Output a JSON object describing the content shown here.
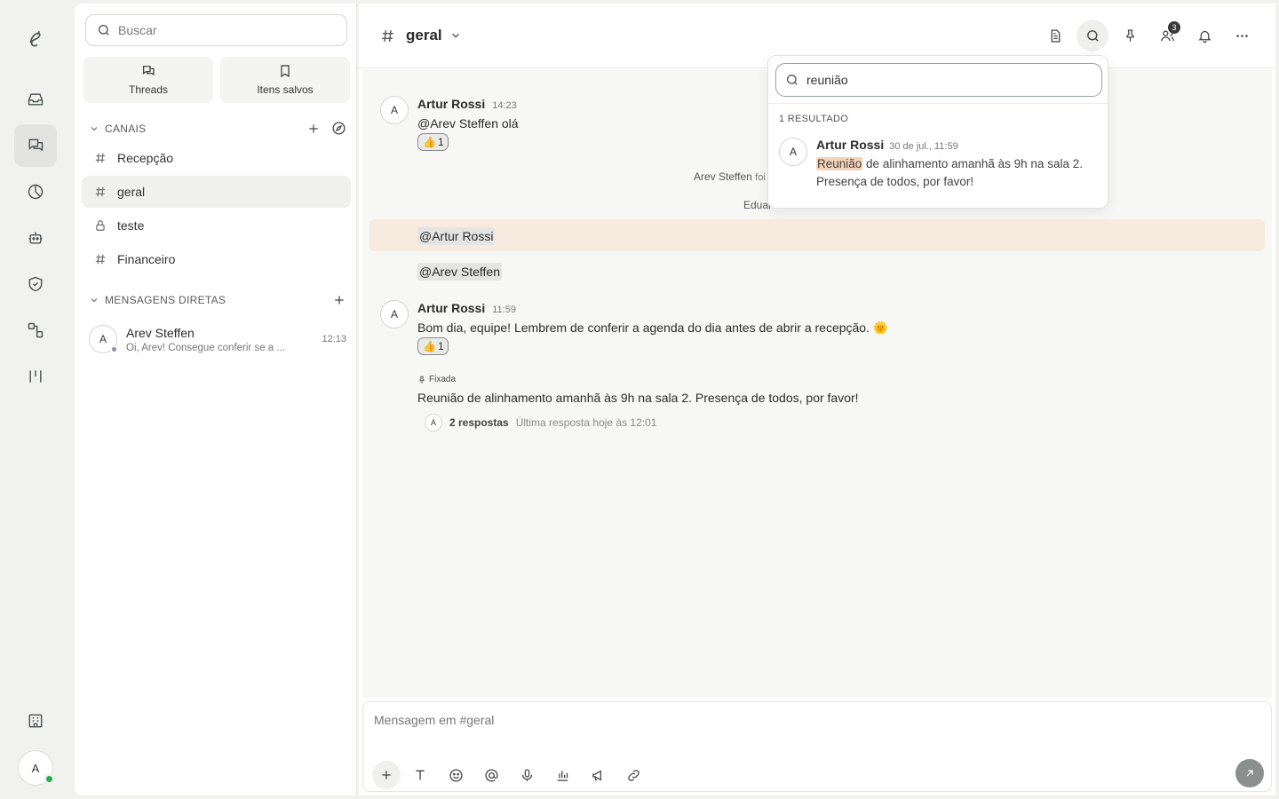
{
  "rail": {
    "icons": [
      "logo-icon",
      "inbox-icon",
      "chat-icon",
      "chart-icon",
      "bot-icon",
      "shield-icon",
      "integrations-icon",
      "kanban-icon",
      "building-icon"
    ],
    "user_initial": "A"
  },
  "sidebar": {
    "search_placeholder": "Buscar",
    "quick": [
      {
        "label": "Threads"
      },
      {
        "label": "Itens salvos"
      }
    ],
    "channels_header": "CANAIS",
    "channels": [
      {
        "name": "Recepção",
        "type": "public"
      },
      {
        "name": "geral",
        "type": "public",
        "active": true
      },
      {
        "name": "teste",
        "type": "private"
      },
      {
        "name": "Financeiro",
        "type": "public"
      }
    ],
    "dm_header": "MENSAGENS DIRETAS",
    "dms": [
      {
        "initial": "A",
        "name": "Arev Steffen",
        "preview": "Oi, Arev! Consegue conferir se a ...",
        "time": "12:13"
      }
    ]
  },
  "header": {
    "hash": "#",
    "channel": "geral",
    "members_badge": "3"
  },
  "messages": {
    "m1": {
      "initial": "A",
      "author": "Artur Rossi",
      "time": "14:23",
      "body": "@Arev Steffen olá",
      "reaction_emoji": "👍",
      "reaction_count": "1"
    },
    "sys1_name": "Arev Steffen",
    "sys1_text": "foi",
    "sys2_text": "Eduar",
    "mention1": "@Artur Rossi",
    "mention2": "@Arev Steffen",
    "m2": {
      "initial": "A",
      "author": "Artur Rossi",
      "time": "11:59",
      "body": "Bom dia, equipe! Lembrem de conferir a agenda do dia antes de abrir a recepção. 🌞",
      "reaction_emoji": "👍",
      "reaction_count": "1"
    },
    "pinned_label": "Fixada",
    "m3_body": "Reunião de alinhamento amanhã às 9h na sala 2. Presença de todos, por favor!",
    "thread": {
      "initial": "A",
      "replies": "2 respostas",
      "last": "Última resposta hoje às 12:01"
    }
  },
  "composer": {
    "placeholder": "Mensagem em #geral"
  },
  "search_popover": {
    "query": "reunião",
    "count": "1 RESULTADO",
    "result": {
      "initial": "A",
      "author": "Artur Rossi",
      "time": "30 de jul., 11:59",
      "highlight": "Reunião",
      "rest": " de alinhamento amanhã às 9h na sala 2. Presença de todos, por favor!"
    }
  },
  "colors": {
    "highlight_row": "#f7ebdf",
    "search_highlight": "#f4d3b8",
    "online": "#22b04c"
  }
}
